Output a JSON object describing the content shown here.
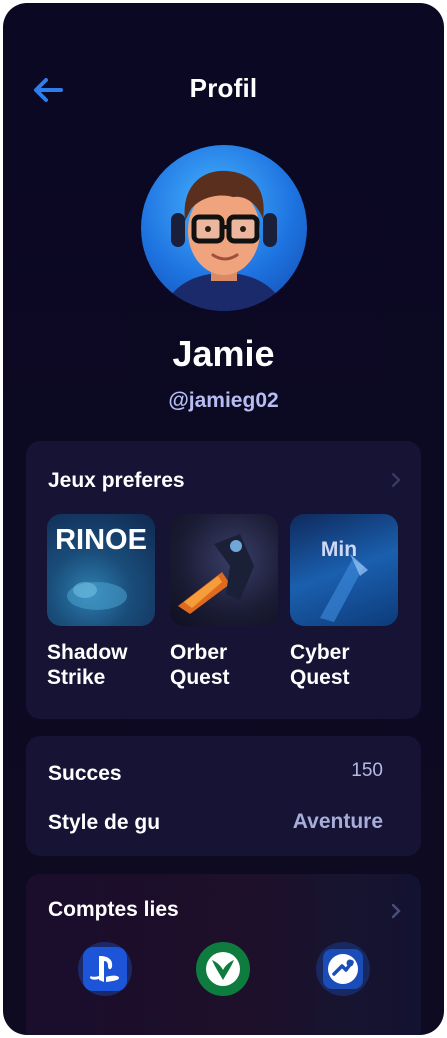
{
  "header": {
    "title": "Profil"
  },
  "profile": {
    "name": "Jamie",
    "handle": "@jamieg02"
  },
  "favorites": {
    "title": "Jeux preferes",
    "games": [
      {
        "name": "Shadow\nStrike",
        "art_text": "RINOE"
      },
      {
        "name": "Orber\nQuest",
        "art_text": ""
      },
      {
        "name": "Cyber\nQuest",
        "art_text": "Min"
      }
    ]
  },
  "stats": {
    "rows": [
      {
        "label": "Succes",
        "value": "150"
      },
      {
        "label": "Style de gu",
        "value": "Aventure"
      }
    ]
  },
  "accounts": {
    "title": "Comptes lies",
    "items": [
      {
        "icon": "playstation-icon"
      },
      {
        "icon": "xbox-icon"
      },
      {
        "icon": "steam-icon"
      }
    ]
  },
  "colors": {
    "background": "#0b0824",
    "card": "#161335",
    "accent_blue": "#2f7dea",
    "handle_text": "#b7bdf2",
    "xbox_green": "#0f7c3f"
  }
}
